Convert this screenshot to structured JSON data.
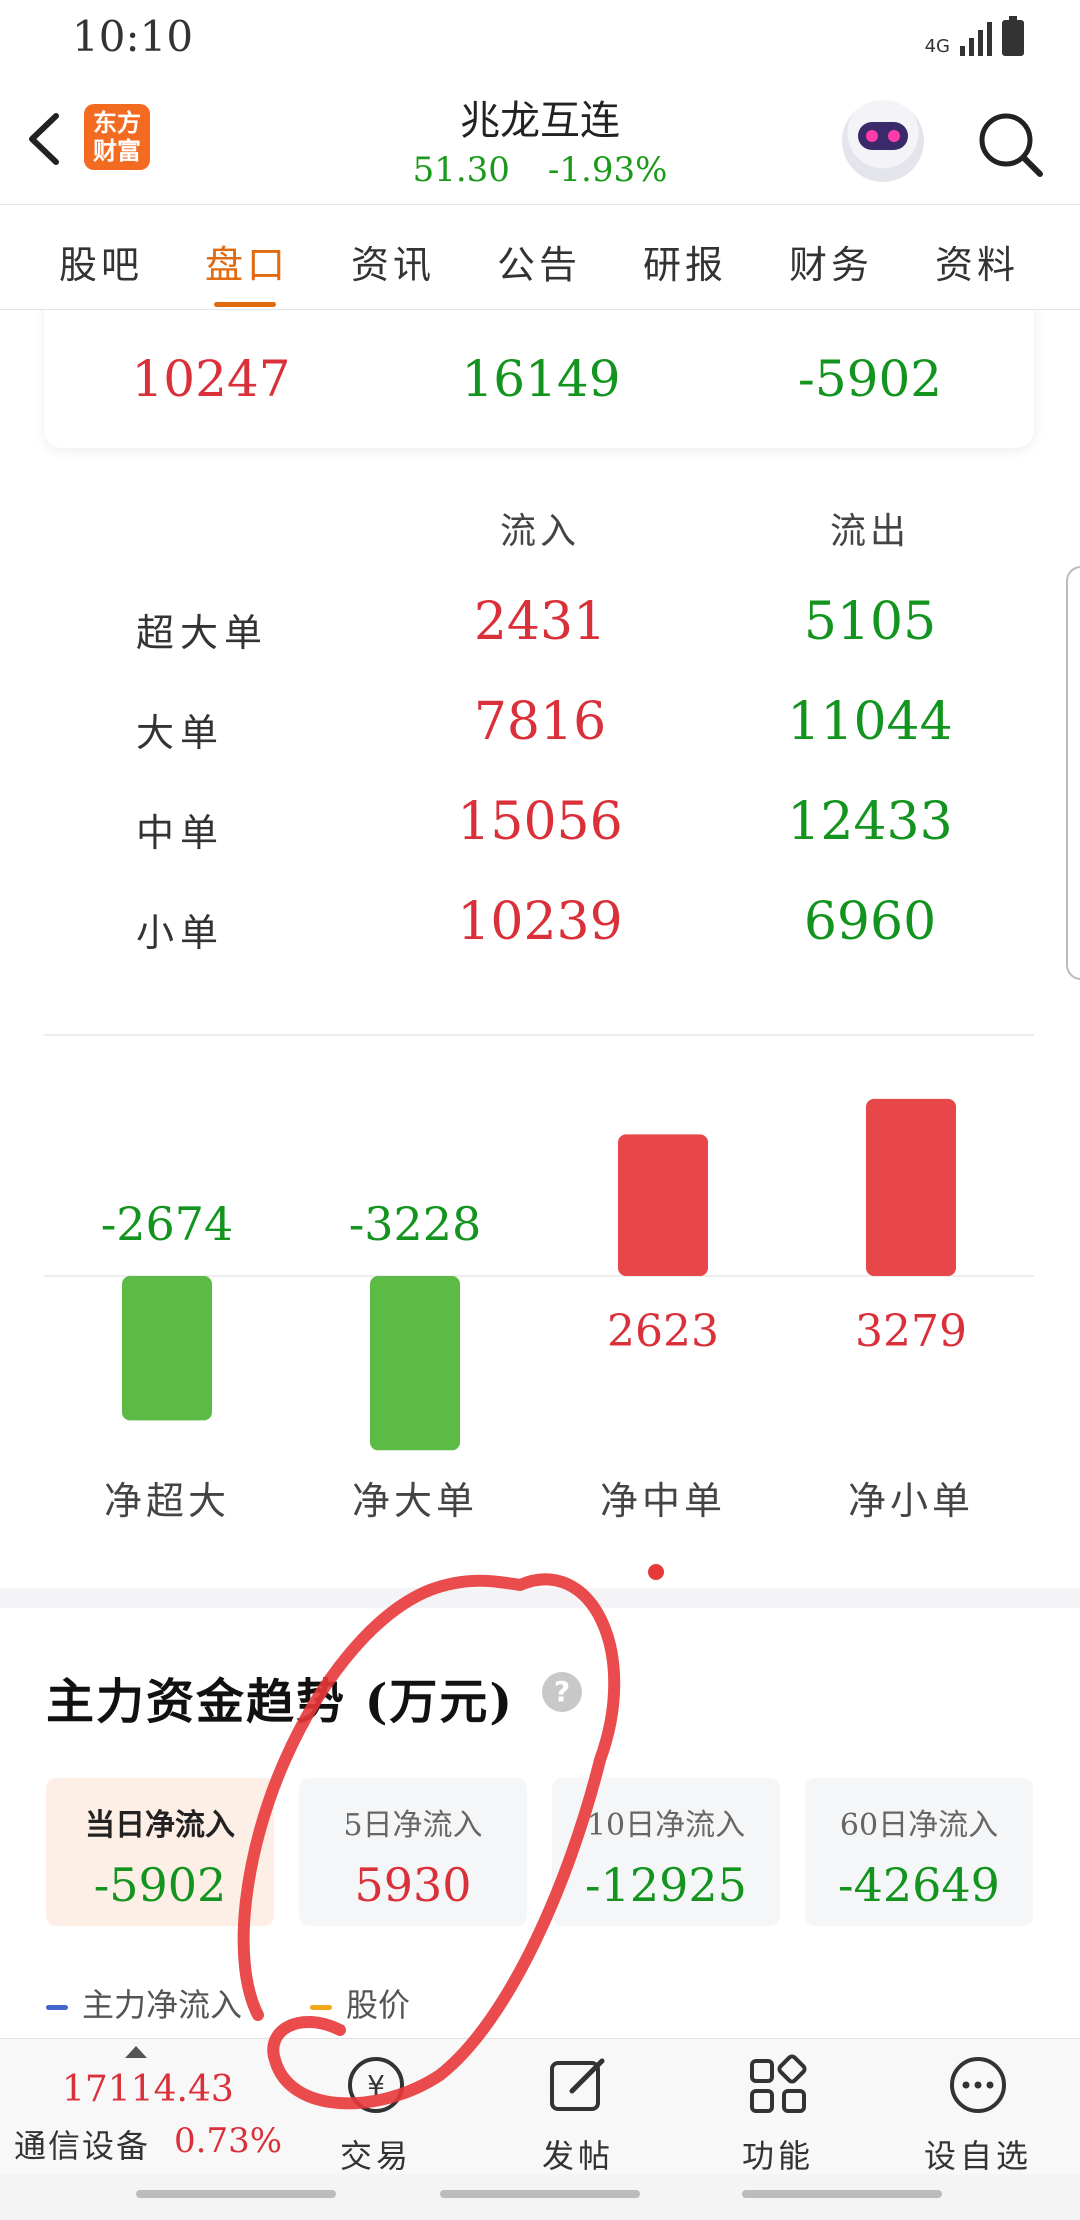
{
  "status_bar": {
    "time": "10:10",
    "network": "4G"
  },
  "header": {
    "logo_text": "东方财富",
    "stock_name": "兆龙互连",
    "price": "51.30",
    "change": "-1.93%"
  },
  "tabs": [
    {
      "label": "股吧",
      "active": false
    },
    {
      "label": "盘口",
      "active": true
    },
    {
      "label": "资讯",
      "active": false
    },
    {
      "label": "公告",
      "active": false
    },
    {
      "label": "研报",
      "active": false
    },
    {
      "label": "财务",
      "active": false
    },
    {
      "label": "资料",
      "active": false
    }
  ],
  "summary": {
    "values": [
      "10247",
      "16149",
      "-5902"
    ]
  },
  "flow_table": {
    "headers": {
      "inflow": "流入",
      "outflow": "流出"
    },
    "rows": [
      {
        "label": "超大单",
        "inflow": "2431",
        "outflow": "5105"
      },
      {
        "label": "大单",
        "inflow": "7816",
        "outflow": "11044"
      },
      {
        "label": "中单",
        "inflow": "15056",
        "outflow": "12433"
      },
      {
        "label": "小单",
        "inflow": "10239",
        "outflow": "6960"
      }
    ]
  },
  "chart_data": {
    "type": "bar",
    "categories": [
      "净超大",
      "净大单",
      "净中单",
      "净小单"
    ],
    "values": [
      -2674,
      -3228,
      2623,
      3279
    ],
    "positive_color": "#e8474a",
    "negative_color": "#5bbb45"
  },
  "trend": {
    "title": "主力资金趋势 (万元)",
    "help": "?",
    "cards": [
      {
        "label": "当日净流入",
        "value": "-5902",
        "tone": "green",
        "active": true
      },
      {
        "label": "5日净流入",
        "value": "5930",
        "tone": "red",
        "active": false
      },
      {
        "label": "10日净流入",
        "value": "-12925",
        "tone": "green",
        "active": false
      },
      {
        "label": "60日净流入",
        "value": "-42649",
        "tone": "green",
        "active": false
      }
    ],
    "legend": [
      {
        "label": "主力净流入",
        "color": "#4466cc"
      },
      {
        "label": "股价",
        "color": "#f0a818"
      }
    ]
  },
  "bottom_bar": {
    "index_value": "17114.43",
    "index_name": "通信设备",
    "index_change": "0.73%",
    "nav": [
      {
        "label": "交易",
        "icon": "trade-icon"
      },
      {
        "label": "发帖",
        "icon": "post-icon"
      },
      {
        "label": "功能",
        "icon": "apps-icon"
      },
      {
        "label": "设自选",
        "icon": "more-icon"
      }
    ]
  },
  "colors": {
    "up": "#d9303a",
    "down": "#12941e",
    "accent": "#e06b10"
  }
}
